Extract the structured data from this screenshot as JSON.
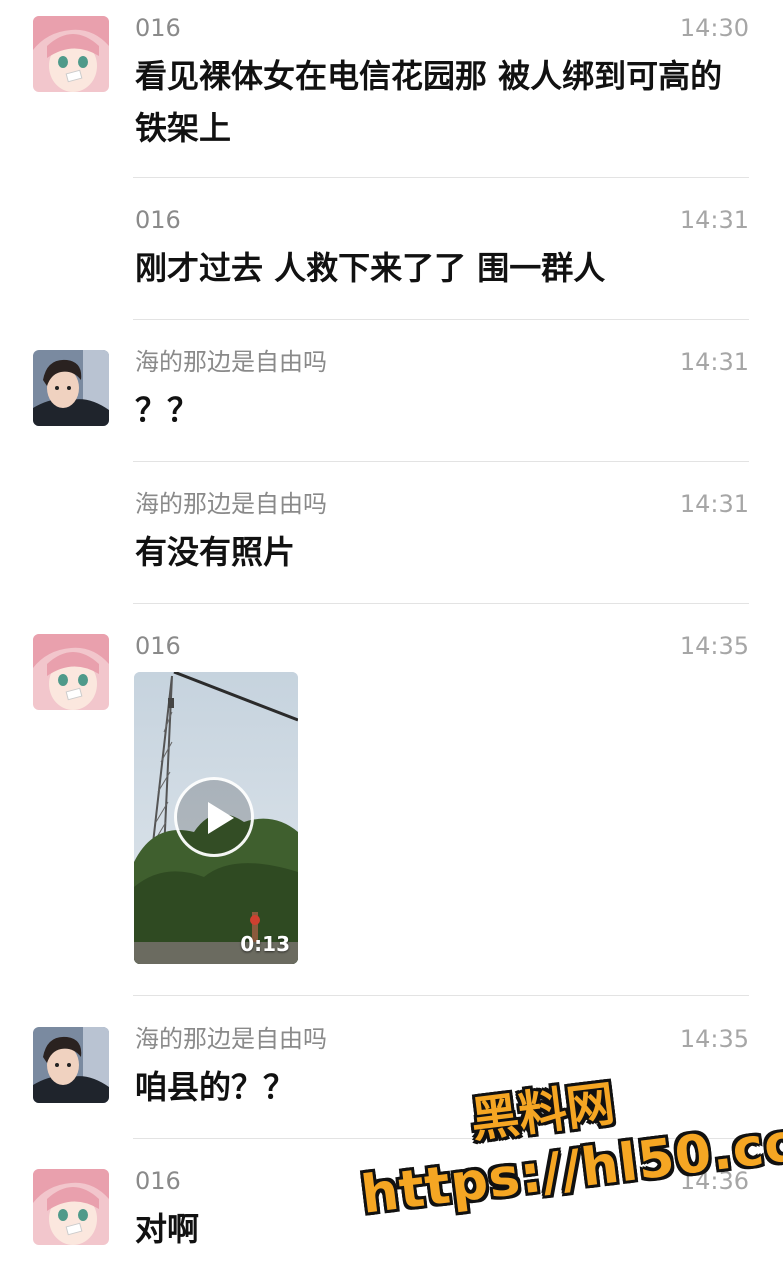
{
  "messages": [
    {
      "sender": "016",
      "time": "14:30",
      "text": "看见裸体女在电信花园那 被人绑到可高的铁架上"
    },
    {
      "sender": "016",
      "time": "14:31",
      "text": "刚才过去 人救下来了了 围一群人"
    },
    {
      "sender": "海的那边是自由吗",
      "time": "14:31",
      "text": "？？"
    },
    {
      "sender": "海的那边是自由吗",
      "time": "14:31",
      "text": "有没有照片"
    },
    {
      "sender": "016",
      "time": "14:35",
      "video_duration": "0:13"
    },
    {
      "sender": "海的那边是自由吗",
      "time": "14:35",
      "text": "咱县的？？"
    },
    {
      "sender": "016",
      "time": "14:36",
      "text": "对啊"
    }
  ],
  "watermark": {
    "title": "黑料网",
    "url": "https://hl50.co"
  },
  "colors": {
    "sender": "#8a8a8a",
    "time": "#a6a6a6",
    "watermark": "#f5a623"
  },
  "icons": {
    "play": "play-icon"
  }
}
